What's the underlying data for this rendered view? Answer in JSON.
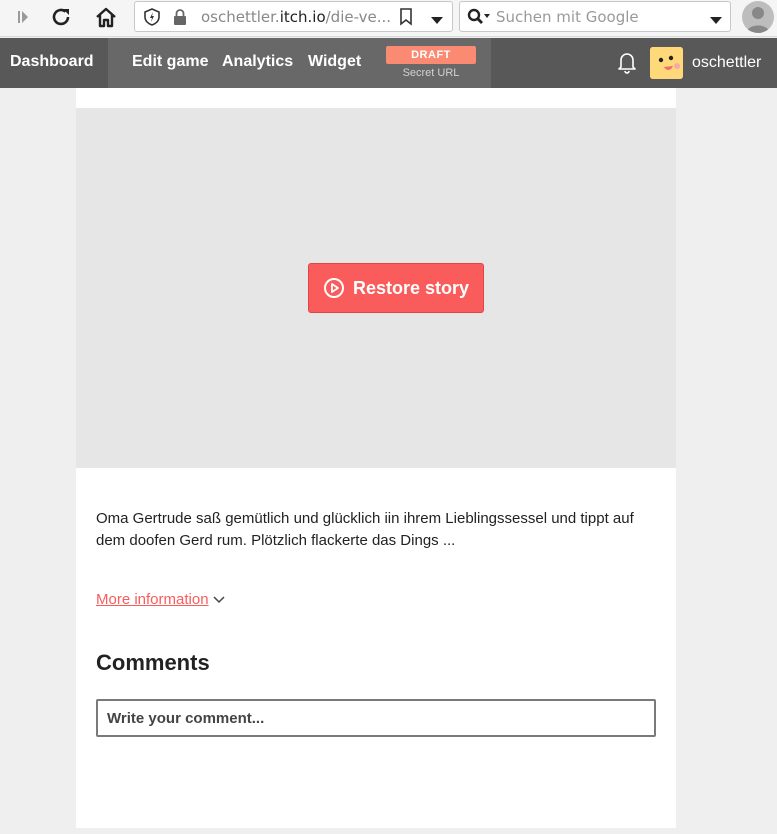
{
  "browser": {
    "url_prefix": "oschettler.",
    "url_host": "itch.io",
    "url_path": "/die-ve...",
    "search_placeholder": "Suchen mit Google"
  },
  "header": {
    "dashboard": "Dashboard",
    "edit_game": "Edit game",
    "analytics": "Analytics",
    "widget": "Widget",
    "draft_badge": "DRAFT",
    "secret_url": "Secret URL",
    "username": "oschettler"
  },
  "game": {
    "restore_label": "Restore story"
  },
  "content": {
    "description": "Oma Gertrude saß gemütlich und glücklich iin ihrem Lieblingssessel und tippt auf dem doofen Gerd rum. Plötzlich flackerte das Dings ...",
    "more_info": "More information",
    "comments_title": "Comments",
    "comment_placeholder": "Write your comment..."
  },
  "colors": {
    "accent": "#fa5c5c",
    "draft": "#fa8a72",
    "header_bg": "#585858"
  }
}
